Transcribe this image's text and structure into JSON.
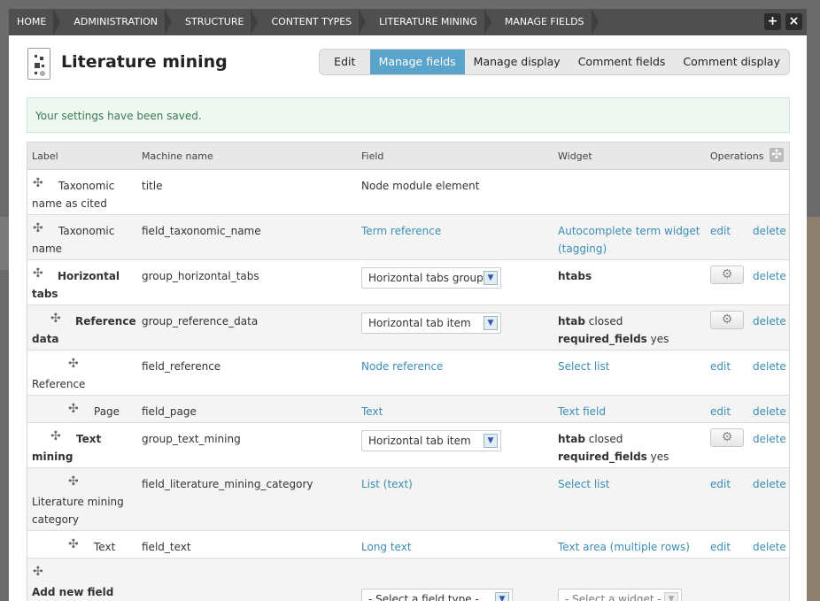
{
  "breadcrumbs": [
    "HOME",
    "ADMINISTRATION",
    "STRUCTURE",
    "CONTENT TYPES",
    "LITERATURE MINING",
    "MANAGE FIELDS"
  ],
  "toolbar": {
    "add_label": "+",
    "close_label": "×"
  },
  "page": {
    "title": "Literature mining"
  },
  "tabs": [
    "Edit",
    "Manage fields",
    "Manage display",
    "Comment fields",
    "Comment display"
  ],
  "message": "Your settings have been saved.",
  "table": {
    "headers": {
      "label": "Label",
      "machine": "Machine name",
      "field": "Field",
      "widget": "Widget",
      "operations": "Operations"
    },
    "rows": [
      {
        "label_1": "Taxonomic",
        "label_2": "name as cited",
        "machine": "title",
        "field": "Node module element"
      },
      {
        "label_1": "Taxonomic",
        "label_2": "name",
        "machine": "field_taxonomic_name",
        "field": "Term reference",
        "widget_1": "Autocomplete term widget",
        "widget_2": "(tagging)",
        "edit": "edit",
        "delete": "delete"
      },
      {
        "label_1": "Horizontal",
        "label_2": "tabs",
        "machine": "group_horizontal_tabs",
        "select": "Horizontal tabs group",
        "widget_key": "htabs",
        "delete": "delete"
      },
      {
        "label_1": "Reference",
        "label_2": "data",
        "machine": "group_reference_data",
        "select": "Horizontal tab item",
        "widget_key_1": "htab",
        "widget_val_1": "closed",
        "widget_key_2": "required_fields",
        "widget_val_2": "yes",
        "delete": "delete"
      },
      {
        "label_1": "Reference",
        "machine": "field_reference",
        "field": "Node reference",
        "widget": "Select list",
        "edit": "edit",
        "delete": "delete"
      },
      {
        "label_1": "Page",
        "machine": "field_page",
        "field": "Text",
        "widget": "Text field",
        "edit": "edit",
        "delete": "delete"
      },
      {
        "label_1": "Text",
        "label_2": "mining",
        "machine": "group_text_mining",
        "select": "Horizontal tab item",
        "widget_key_1": "htab",
        "widget_val_1": "closed",
        "widget_key_2": "required_fields",
        "widget_val_2": "yes",
        "delete": "delete"
      },
      {
        "label_1": "Literature mining",
        "label_2": "category",
        "machine": "field_literature_mining_category",
        "field": "List (text)",
        "widget": "Select list",
        "edit": "edit",
        "delete": "delete"
      },
      {
        "label_1": "Text",
        "machine": "field_text",
        "field": "Long text",
        "widget": "Text area (multiple rows)",
        "edit": "edit",
        "delete": "delete"
      }
    ],
    "add_new": {
      "label": "Add new field",
      "field_type_placeholder": "- Select a field type -",
      "widget_placeholder": "- Select a widget -"
    }
  }
}
